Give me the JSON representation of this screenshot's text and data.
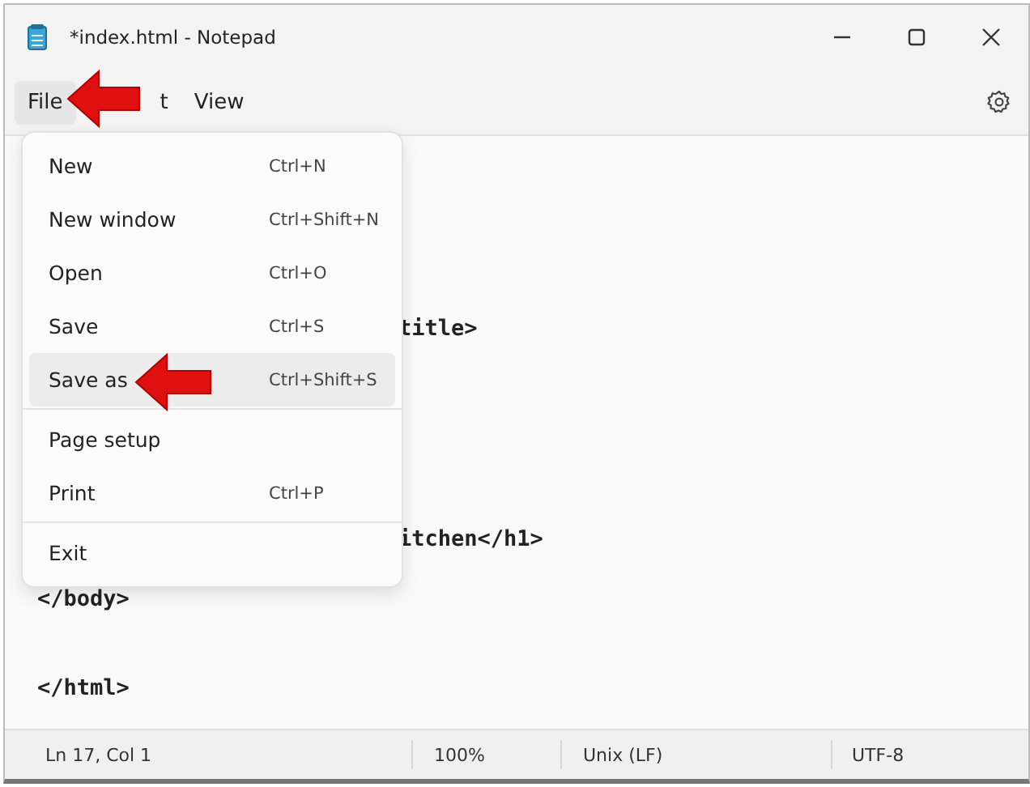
{
  "window": {
    "title": "*index.html - Notepad"
  },
  "menu_bar": [
    {
      "label": "File",
      "selected": true
    },
    {
      "label": "t",
      "selected": false
    },
    {
      "label": "View",
      "selected": false
    }
  ],
  "file_menu": {
    "items": [
      {
        "label": "New",
        "shortcut": "Ctrl+N",
        "selected": false,
        "separator_before": false
      },
      {
        "label": "New window",
        "shortcut": "Ctrl+Shift+N",
        "selected": false,
        "separator_before": false
      },
      {
        "label": "Open",
        "shortcut": "Ctrl+O",
        "selected": false,
        "separator_before": false
      },
      {
        "label": "Save",
        "shortcut": "Ctrl+S",
        "selected": false,
        "separator_before": false
      },
      {
        "label": "Save as",
        "shortcut": "Ctrl+Shift+S",
        "selected": true,
        "separator_before": false
      },
      {
        "label": "Page setup",
        "selected": false,
        "separator_before": true
      },
      {
        "label": "Print",
        "shortcut": "Ctrl+P",
        "selected": false,
        "separator_before": false
      },
      {
        "label": "Exit",
        "selected": false,
        "separator_before": true
      }
    ]
  },
  "editor": {
    "lines": [
      {
        "kind": "covered"
      },
      {
        "kind": "covered"
      },
      {
        "kind": "covered"
      },
      {
        "kind": "covered"
      },
      {
        "kind": "partial",
        "text": "title>"
      },
      {
        "kind": "covered"
      },
      {
        "kind": "covered"
      },
      {
        "kind": "covered"
      },
      {
        "kind": "covered"
      },
      {
        "kind": "covered"
      },
      {
        "kind": "covered"
      },
      {
        "kind": "partial",
        "text": "itchen</h1>"
      },
      {
        "kind": "covered"
      },
      {
        "kind": "full",
        "text": "</body>"
      },
      {
        "kind": "blank"
      },
      {
        "kind": "blank"
      },
      {
        "kind": "full",
        "text": "</html>"
      }
    ]
  },
  "status_bar": {
    "position": "Ln 17, Col 1",
    "zoom": "100%",
    "line_ending": "Unix (LF)",
    "encoding": "UTF-8"
  }
}
